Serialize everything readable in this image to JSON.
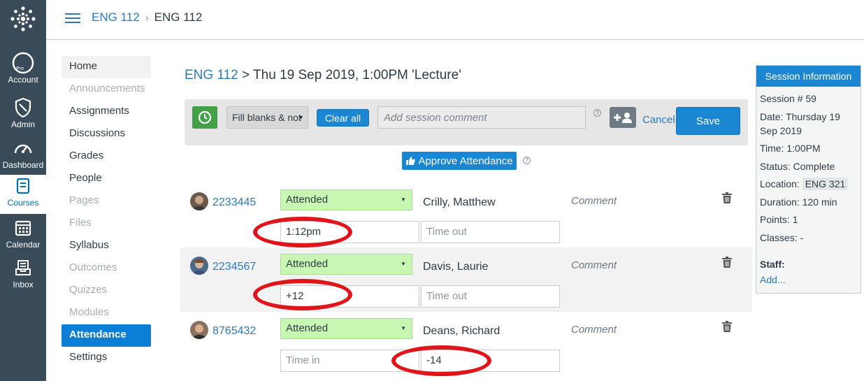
{
  "global_nav": {
    "items": [
      {
        "label": "Account",
        "icon": "account-icon"
      },
      {
        "label": "Admin",
        "icon": "admin-shield-icon"
      },
      {
        "label": "Dashboard",
        "icon": "dashboard-gauge-icon"
      },
      {
        "label": "Courses",
        "icon": "courses-book-icon"
      },
      {
        "label": "Calendar",
        "icon": "calendar-icon"
      },
      {
        "label": "Inbox",
        "icon": "inbox-icon"
      }
    ],
    "avatar_alt": "Pro"
  },
  "header": {
    "breadcrumb": [
      "ENG 112",
      "ENG 112"
    ],
    "separator": "›"
  },
  "course_nav": [
    {
      "label": "Home",
      "state": "first"
    },
    {
      "label": "Announcements",
      "state": "disabled"
    },
    {
      "label": "Assignments",
      "state": "normal"
    },
    {
      "label": "Discussions",
      "state": "normal"
    },
    {
      "label": "Grades",
      "state": "normal"
    },
    {
      "label": "People",
      "state": "normal"
    },
    {
      "label": "Pages",
      "state": "disabled"
    },
    {
      "label": "Files",
      "state": "disabled"
    },
    {
      "label": "Syllabus",
      "state": "normal"
    },
    {
      "label": "Outcomes",
      "state": "disabled"
    },
    {
      "label": "Quizzes",
      "state": "disabled"
    },
    {
      "label": "Modules",
      "state": "disabled"
    },
    {
      "label": "Attendance",
      "state": "active"
    },
    {
      "label": "Settings",
      "state": "normal"
    }
  ],
  "main": {
    "title_link": "ENG 112",
    "title_rest": " > Thu 19 Sep 2019, 1:00PM 'Lecture'",
    "toolbar": {
      "fill_select": "Fill blanks & not",
      "clear_all": "Clear all",
      "comment_placeholder": "Add session comment",
      "help": "?",
      "cancel": "Cancel",
      "save": "Save"
    },
    "approve": "Approve Attendance",
    "approve_help": "?"
  },
  "students": [
    {
      "id": "2233445",
      "status": "Attended",
      "name": "Crilly, Matthew",
      "comment": "Comment",
      "time_in": "1:12pm",
      "time_out": "",
      "time_in_placeholder": "Time in",
      "time_out_placeholder": "Time out"
    },
    {
      "id": "2234567",
      "status": "Attended",
      "name": "Davis, Laurie",
      "comment": "Comment",
      "time_in": "+12",
      "time_out": "",
      "time_in_placeholder": "Time in",
      "time_out_placeholder": "Time out"
    },
    {
      "id": "8765432",
      "status": "Attended",
      "name": "Deans, Richard",
      "comment": "Comment",
      "time_in": "",
      "time_out": "-14",
      "time_in_placeholder": "Time in",
      "time_out_placeholder": "Time out"
    }
  ],
  "session_info": {
    "title": "Session Information",
    "session": "Session # 59",
    "date": "Date: Thursday 19 Sep 2019",
    "time": "Time: 1:00PM",
    "status": "Status: Complete",
    "location_label": "Location:",
    "location_value": "ENG 321",
    "duration": "Duration: 120 min",
    "points": "Points: 1",
    "classes": "Classes: -",
    "staff_label": "Staff:",
    "add_link": "Add..."
  },
  "colors": {
    "nav_bg": "#394b58",
    "link": "#2b7abc",
    "primary": "#1b86d1",
    "attended_bg": "#c8f7b4",
    "highlight_circle": "#e0141b",
    "clock_green": "#43a047"
  }
}
